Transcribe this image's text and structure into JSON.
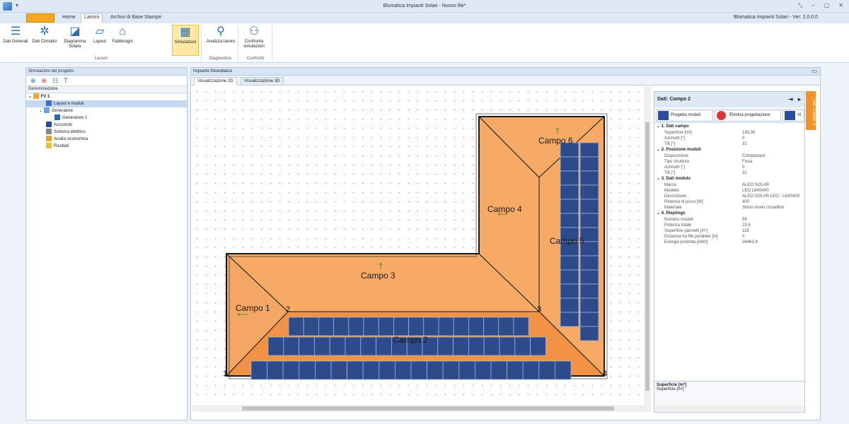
{
  "window": {
    "title": "Blumatica Impianti Solari - Nuovo file*",
    "version": "Blumatica Impianti Solari - Ver: 2.0.0.0"
  },
  "tabs": [
    "Home",
    "Lavoro",
    "Archivi di Base",
    "Stampe"
  ],
  "ribbon": {
    "buttons": [
      {
        "label": "Dati Generali",
        "icon": "list-icon"
      },
      {
        "label": "Dati Climatici",
        "icon": "sun-icon"
      },
      {
        "label": "Diagramma Solare",
        "icon": "solar-diagram-icon"
      },
      {
        "label": "Layout",
        "icon": "layout-icon"
      },
      {
        "label": "Fabbisogni",
        "icon": "house-icon"
      },
      {
        "label": "Simulazioni",
        "icon": "simulation-icon"
      },
      {
        "label": "Analizza lavoro",
        "icon": "magnifier-icon"
      },
      {
        "label": "Confronta simulazioni",
        "icon": "compare-icon"
      }
    ],
    "groups": [
      "Lavoro",
      "Diagnostica",
      "Confronti"
    ]
  },
  "left_panel": {
    "header": "Simulazioni del progetto",
    "column": "Denominazione",
    "tree": [
      {
        "label": "FV 1",
        "level": 0
      },
      {
        "label": "Layout e moduli",
        "level": 1,
        "selected": true
      },
      {
        "label": "Generatore",
        "level": 1
      },
      {
        "label": "Generatore 1",
        "level": 2
      },
      {
        "label": "Accumulo",
        "level": 1
      },
      {
        "label": "Schema elettrico",
        "level": 1
      },
      {
        "label": "Analisi economica",
        "level": 1
      },
      {
        "label": "Risultati",
        "level": 1
      }
    ]
  },
  "main": {
    "header": "Impianto fotovoltaico",
    "view_tabs": [
      "Visualizzazione 2D",
      "Visualizzazione 3D"
    ],
    "fields": [
      "Campo 1",
      "Campo 2",
      "Campo 3",
      "Campo 4",
      "Campo 5",
      "Campo 6"
    ],
    "vertices": [
      "1",
      "2",
      "3",
      "4"
    ]
  },
  "props": {
    "title": "Dati: Campo 2",
    "buttons": [
      "Progetta moduli",
      "Elimina progettazione",
      "Vi"
    ],
    "sections": [
      {
        "title": "1. Dati campo",
        "rows": [
          [
            "Superficie [m²]",
            "145,35"
          ],
          [
            "Azimuth [°]",
            "0"
          ],
          [
            "Tilt [°]",
            "31"
          ]
        ]
      },
      {
        "title": "2. Posizione moduli",
        "rows": [
          [
            "Disposizione",
            "Complanare"
          ],
          [
            "Tipo struttura",
            "Fissa"
          ],
          [
            "Azimuth [°]",
            "0"
          ],
          [
            "Tilt [°]",
            "31"
          ]
        ]
      },
      {
        "title": "3. Dati modulo",
        "rows": [
          [
            "Marca",
            "ALEO SOLAR"
          ],
          [
            "Modello",
            "LEO L64S400"
          ],
          [
            "Descrizione",
            "ALEO SOLAR LEO - L64S400"
          ],
          [
            "Potenza di picco [W]",
            "400"
          ],
          [
            "Materiale",
            "Silicio mono cristallino"
          ]
        ]
      },
      {
        "title": "4. Riepilogo",
        "rows": [
          [
            "Numero moduli",
            "59"
          ],
          [
            "Potenza totale",
            "23,6"
          ],
          [
            "Superficie pannelli [m²]",
            "118"
          ],
          [
            "Distanza tra file parallele [m]",
            "0"
          ],
          [
            "Energia prodotta [kWh]",
            "26463,4"
          ]
        ]
      }
    ],
    "footer_title": "Superficie [m²]",
    "footer_desc": "Superficie [m²]",
    "side_tab": "Dati: Campo 2"
  }
}
